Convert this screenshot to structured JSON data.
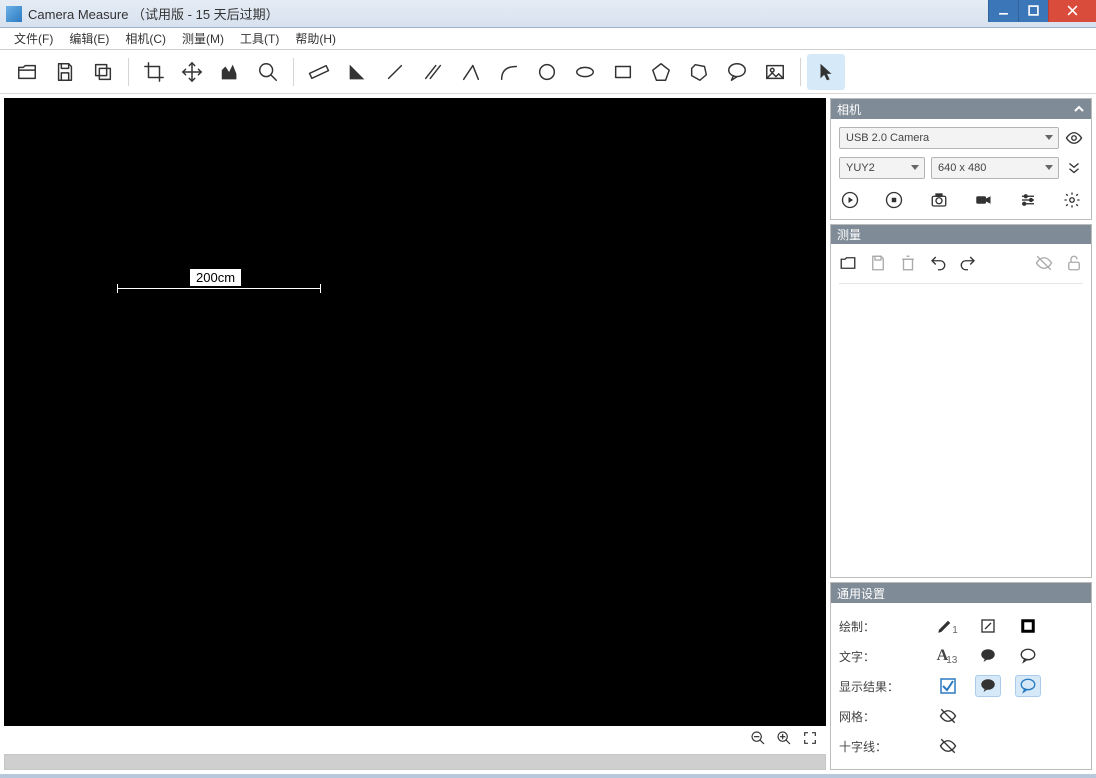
{
  "title": "Camera Measure （试用版 - 15 天后过期）",
  "menu": {
    "file": "文件(F)",
    "edit": "编辑(E)",
    "camera": "相机(C)",
    "measure": "测量(M)",
    "tools": "工具(T)",
    "help": "帮助(H)"
  },
  "canvas": {
    "measure_label": "200cm"
  },
  "panels": {
    "camera": {
      "title": "相机",
      "device": "USB 2.0 Camera",
      "format": "YUY2",
      "resolution": "640 x 480"
    },
    "measure": {
      "title": "测量"
    },
    "general": {
      "title": "通用设置",
      "labels": {
        "draw": "绘制：",
        "text": "文字：",
        "show": "显示结果：",
        "grid": "网格：",
        "cross": "十字线："
      },
      "pen_size": "1",
      "font_size": "13"
    }
  }
}
